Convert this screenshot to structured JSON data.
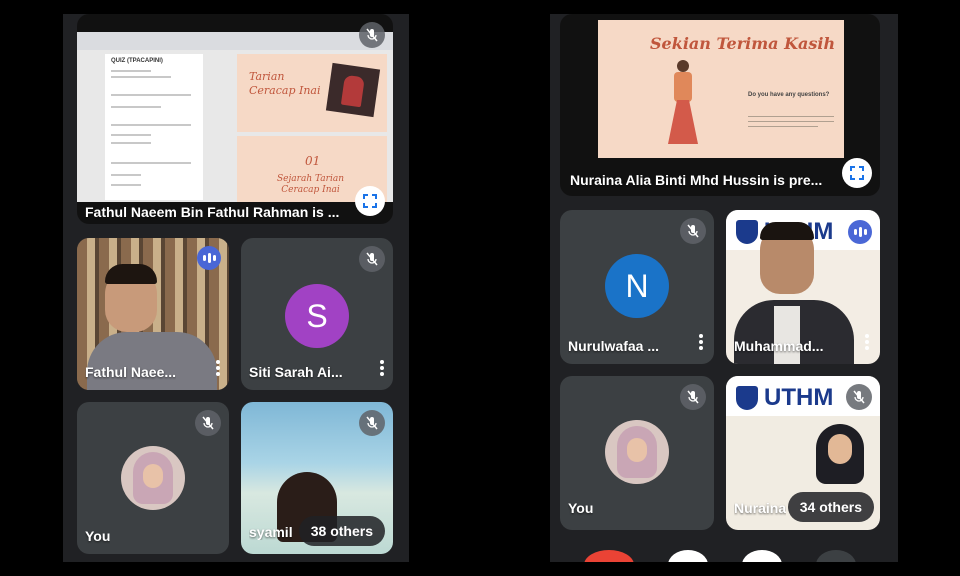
{
  "left_phone": {
    "presentation_tile": {
      "name": "Fathul Naeem Bin Fathul Rahman is ...",
      "doc_title": "QUIZ (TPACAPINI)",
      "slide1_title_a": "Tarian",
      "slide1_title_b": "Ceracap Inai",
      "slide2_number": "01",
      "slide2_title_a": "Sejarah Tarian",
      "slide2_title_b": "Ceracap Inai"
    },
    "tiles": [
      {
        "name": "Fathul Naee...",
        "speaking": true
      },
      {
        "name": "Siti Sarah Ai...",
        "initial": "S",
        "avatar_color": "#a142c4"
      },
      {
        "name": "You"
      },
      {
        "name": "syamil",
        "others": "38 others"
      }
    ]
  },
  "right_phone": {
    "presentation_tile": {
      "name": "Nuraina Alia Binti Mhd Hussin is pre...",
      "slide_title": "Sekian Terima Kasih",
      "slide_question": "Do you have any questions?"
    },
    "tiles": [
      {
        "name": "Nurulwafaa ...",
        "initial": "N",
        "avatar_color": "#1a73c8"
      },
      {
        "name": "Muhammad...",
        "speaking": true,
        "banner_text": "UTHM"
      },
      {
        "name": "You"
      },
      {
        "name": "Nuraina",
        "others": "34 others",
        "banner_text": "UTHM"
      }
    ]
  },
  "colors": {
    "tile_bg": "#3c4043",
    "phone_bg": "#202124",
    "speaking_blue": "#4a67d6",
    "end_call_red": "#ea4335"
  }
}
